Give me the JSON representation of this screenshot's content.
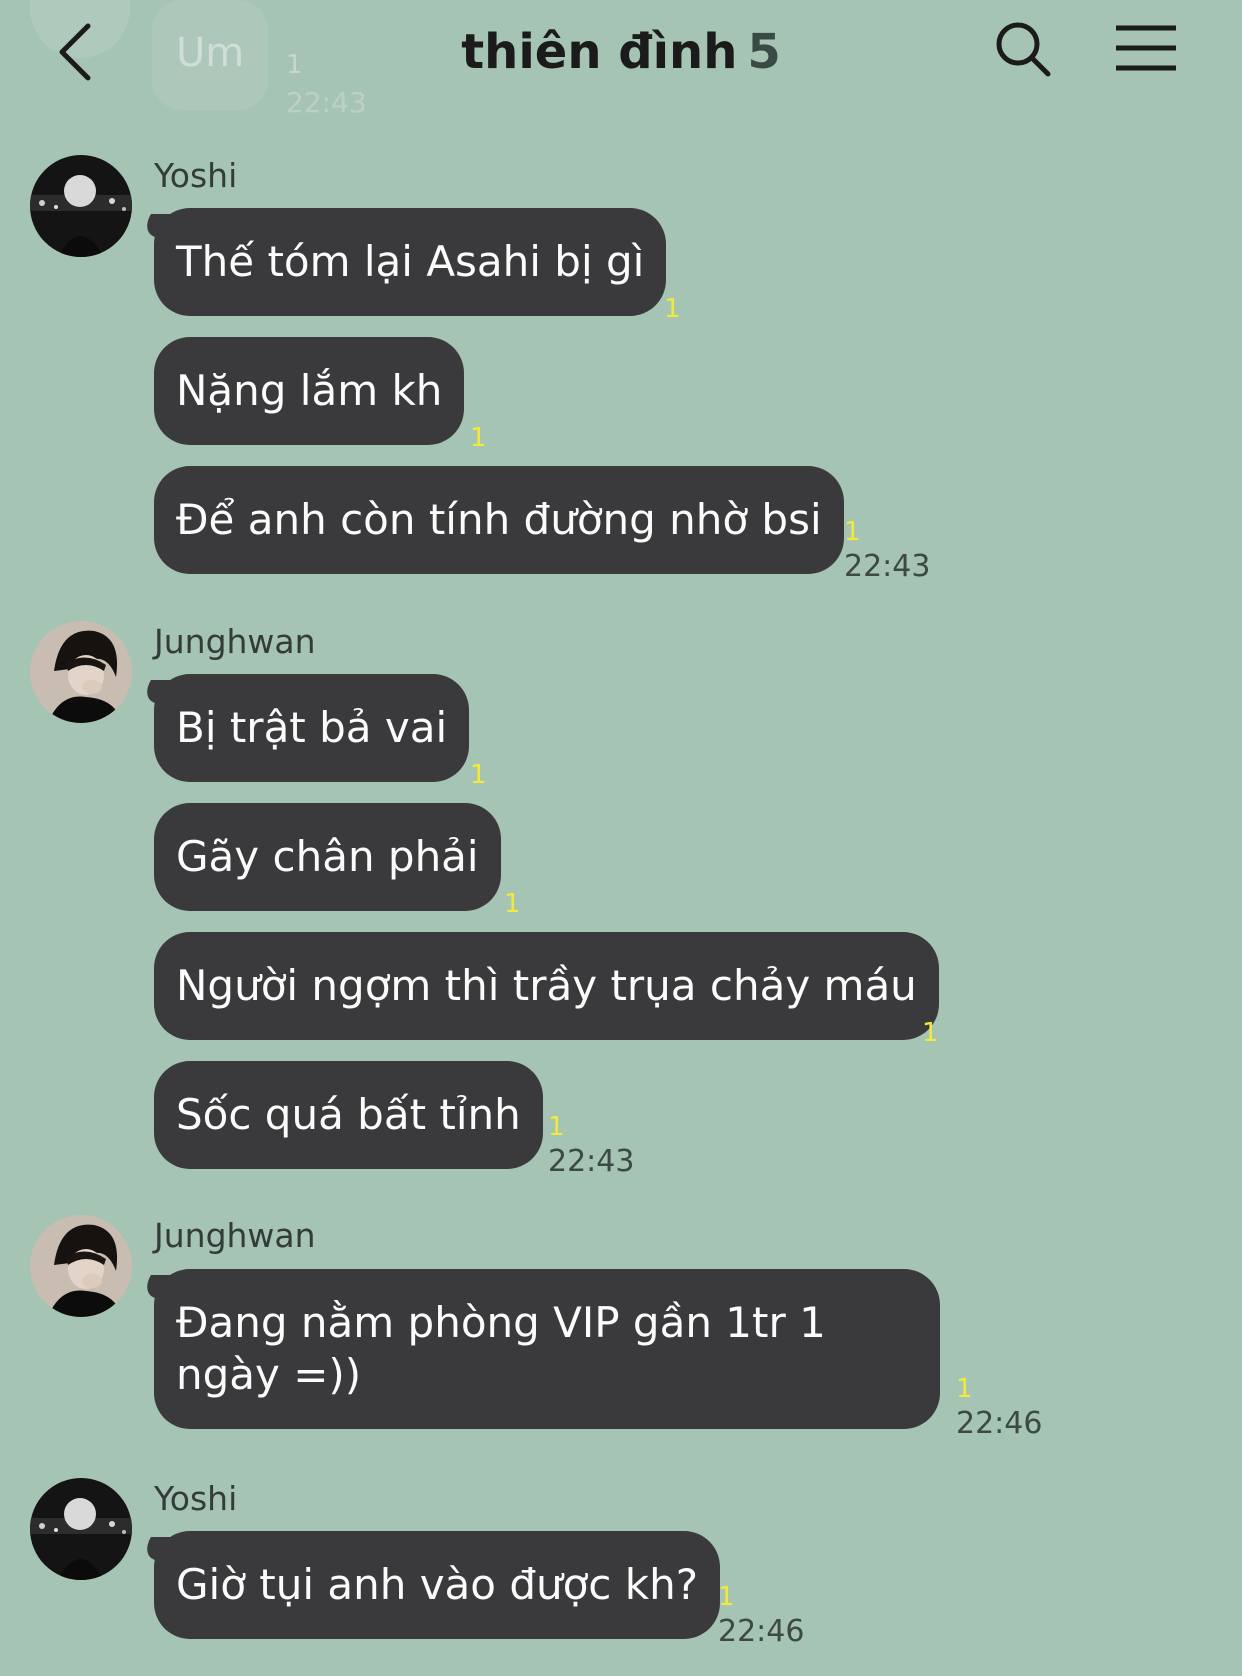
{
  "header": {
    "title": "thiên đình",
    "member_count": "5",
    "back_icon": "chevron-left-icon",
    "search_icon": "search-icon",
    "menu_icon": "hamburger-menu-icon"
  },
  "previous_message": {
    "text": "Um",
    "read_count": "1",
    "time": "22:43"
  },
  "groups": [
    {
      "sender": "Yoshi",
      "messages": [
        {
          "text": "Thế tóm lại Asahi bị gì",
          "read_count": "1"
        },
        {
          "text": "Nặng lắm kh",
          "read_count": "1"
        },
        {
          "text": "Để anh còn tính đường nhờ bsi",
          "read_count": "1",
          "time": "22:43"
        }
      ]
    },
    {
      "sender": "Junghwan",
      "messages": [
        {
          "text": "Bị trật bả vai",
          "read_count": "1"
        },
        {
          "text": "Gãy chân phải",
          "read_count": "1"
        },
        {
          "text": "Người ngợm thì trầy trụa chảy máu",
          "read_count": "1"
        },
        {
          "text": "Sốc quá bất tỉnh",
          "read_count": "1",
          "time": "22:43"
        }
      ]
    },
    {
      "sender": "Junghwan",
      "messages": [
        {
          "text": "Đang nằm phòng VIP gần 1tr 1 ngày =))",
          "read_count": "1",
          "time": "22:46"
        }
      ]
    },
    {
      "sender": "Yoshi",
      "messages": [
        {
          "text": "Giờ tụi anh vào được kh?",
          "read_count": "1",
          "time": "22:46"
        }
      ]
    }
  ],
  "colors": {
    "background": "#a6c4b4",
    "bubble": "#3a3a3c",
    "bubble_text": "#fbfbfb",
    "read_count": "#f2e93a"
  }
}
